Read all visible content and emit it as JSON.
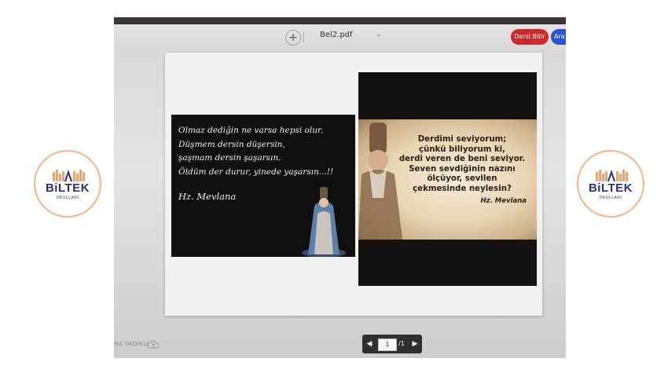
{
  "toolbar": {
    "add_label": "+",
    "file_name": "Bel2.pdf",
    "end_lesson_label": "Dersi Bitir",
    "break_label": "Ara V"
  },
  "left_image": {
    "lines": [
      "Olmaz dediğin ne varsa hepsi olur.",
      "Düşmem dersin düşersin,",
      "şaşmam dersin şaşarsın.",
      "Öldüm der durur, yinede yaşarsın...!!"
    ],
    "author": "Hz. Mevlana"
  },
  "right_image": {
    "lines": [
      "Derdimi seviyorum;",
      "çünkü biliyorum ki,",
      "derdi veren de beni seviyor.",
      "Seven sevdiğinin nazını",
      "ölçüyor,  sevilen",
      "çekmesinde neylesin?"
    ],
    "author": "Hz. Mevlana"
  },
  "pager": {
    "current_page": "1",
    "total_label": "/1"
  },
  "bottom_left_text": "MA GEDİKLİ",
  "logo": {
    "brand": "BiLTEK",
    "sub": "OKULLARI"
  },
  "colors": {
    "end_lesson": "#cc2b2b",
    "break": "#2c53d6",
    "logo_blue": "#2b2f7c",
    "logo_orange": "#f0a36e"
  }
}
